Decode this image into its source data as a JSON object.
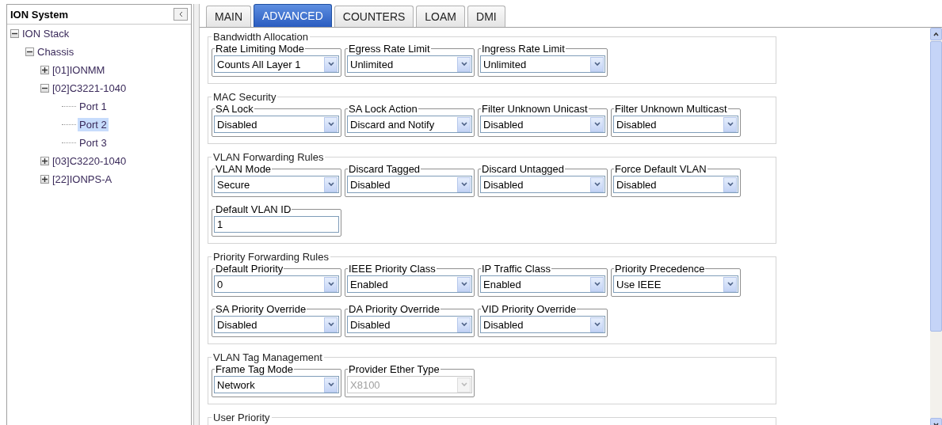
{
  "sidebar": {
    "title": "ION System",
    "tree": [
      {
        "label": "ION Stack",
        "expanded": true,
        "selected": false,
        "children": [
          {
            "label": "Chassis",
            "expanded": true,
            "selected": false,
            "children": [
              {
                "label": "[01]IONMM",
                "expanded": false,
                "selected": false
              },
              {
                "label": "[02]C3221-1040",
                "expanded": true,
                "selected": false,
                "children": [
                  {
                    "label": "Port 1",
                    "selected": false
                  },
                  {
                    "label": "Port 2",
                    "selected": true
                  },
                  {
                    "label": "Port 3",
                    "selected": false
                  }
                ]
              },
              {
                "label": "[03]C3220-1040",
                "expanded": false,
                "selected": false
              },
              {
                "label": "[22]IONPS-A",
                "expanded": false,
                "selected": false
              }
            ]
          }
        ]
      }
    ]
  },
  "tabs": [
    {
      "label": "MAIN",
      "selected": false
    },
    {
      "label": "ADVANCED",
      "selected": true
    },
    {
      "label": "COUNTERS",
      "selected": false
    },
    {
      "label": "LOAM",
      "selected": false
    },
    {
      "label": "DMI",
      "selected": false
    }
  ],
  "sections": [
    {
      "title": "Bandwidth Allocation",
      "rows": [
        [
          {
            "kind": "select",
            "label": "Rate Limiting Mode",
            "value": "Counts All Layer 1",
            "disabled": false
          },
          {
            "kind": "select",
            "label": "Egress Rate Limit",
            "value": "Unlimited",
            "disabled": false
          },
          {
            "kind": "select",
            "label": "Ingress Rate Limit",
            "value": "Unlimited",
            "disabled": false
          }
        ]
      ]
    },
    {
      "title": "MAC Security",
      "rows": [
        [
          {
            "kind": "select",
            "label": "SA Lock",
            "value": "Disabled",
            "disabled": false
          },
          {
            "kind": "select",
            "label": "SA Lock Action",
            "value": "Discard and Notify",
            "disabled": false
          },
          {
            "kind": "select",
            "label": "Filter Unknown Unicast",
            "value": "Disabled",
            "disabled": false
          },
          {
            "kind": "select",
            "label": "Filter Unknown Multicast",
            "value": "Disabled",
            "disabled": false
          }
        ]
      ]
    },
    {
      "title": "VLAN Forwarding Rules",
      "rows": [
        [
          {
            "kind": "select",
            "label": "VLAN Mode",
            "value": "Secure",
            "disabled": false
          },
          {
            "kind": "select",
            "label": "Discard Tagged",
            "value": "Disabled",
            "disabled": false
          },
          {
            "kind": "select",
            "label": "Discard Untagged",
            "value": "Disabled",
            "disabled": false
          },
          {
            "kind": "select",
            "label": "Force Default VLAN",
            "value": "Disabled",
            "disabled": false
          }
        ],
        [
          {
            "kind": "text",
            "label": "Default VLAN ID",
            "value": "1",
            "disabled": false
          }
        ]
      ]
    },
    {
      "title": "Priority Forwarding Rules",
      "rows": [
        [
          {
            "kind": "select",
            "label": "Default Priority",
            "value": "0",
            "disabled": false
          },
          {
            "kind": "select",
            "label": "IEEE Priority Class",
            "value": "Enabled",
            "disabled": false
          },
          {
            "kind": "select",
            "label": "IP Traffic Class",
            "value": "Enabled",
            "disabled": false
          },
          {
            "kind": "select",
            "label": "Priority Precedence",
            "value": "Use IEEE",
            "disabled": false
          }
        ],
        [
          {
            "kind": "select",
            "label": "SA Priority Override",
            "value": "Disabled",
            "disabled": false
          },
          {
            "kind": "select",
            "label": "DA Priority Override",
            "value": "Disabled",
            "disabled": false
          },
          {
            "kind": "select",
            "label": "VID Priority Override",
            "value": "Disabled",
            "disabled": false
          }
        ]
      ]
    },
    {
      "title": "VLAN Tag Management",
      "rows": [
        [
          {
            "kind": "select",
            "label": "Frame Tag Mode",
            "value": "Network",
            "disabled": false
          },
          {
            "kind": "select",
            "label": "Provider Ether Type",
            "value": "X8100",
            "disabled": true
          }
        ]
      ]
    },
    {
      "title": "User Priority"
    }
  ]
}
